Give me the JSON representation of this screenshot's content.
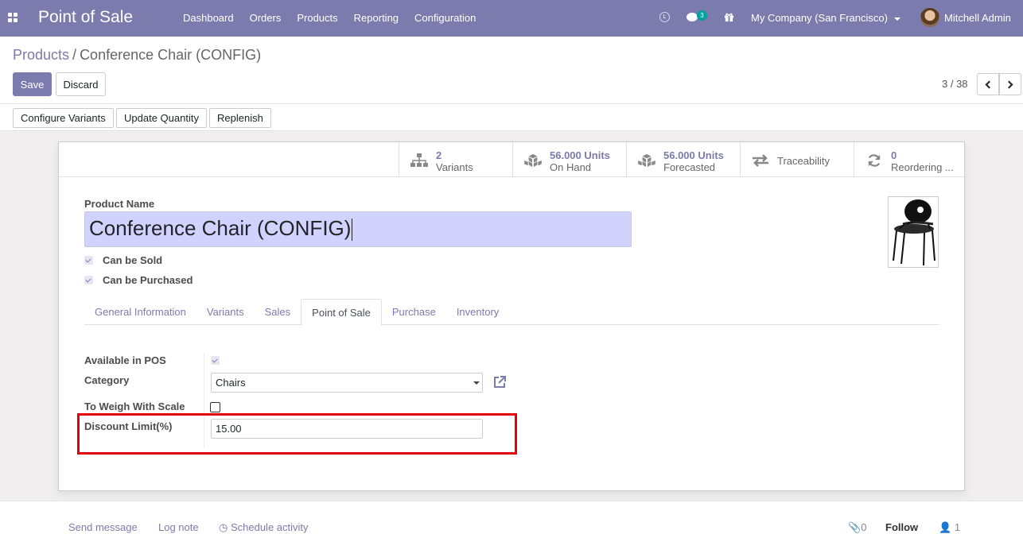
{
  "navbar": {
    "app_title": "Point of Sale",
    "menu": [
      "Dashboard",
      "Orders",
      "Products",
      "Reporting",
      "Configuration"
    ],
    "chat_count": "3",
    "company": "My Company (San Francisco)",
    "user": "Mitchell Admin",
    "brand_color": "#7c7bad"
  },
  "breadcrumb": {
    "parent": "Products",
    "separator": "/",
    "current": "Conference Chair (CONFIG)"
  },
  "actions": {
    "save_label": "Save",
    "discard_label": "Discard"
  },
  "pager": {
    "value": "3 / 38"
  },
  "header_buttons": [
    "Configure Variants",
    "Update Quantity",
    "Replenish"
  ],
  "smart_buttons": [
    {
      "icon": "sitemap-icon",
      "value": "2",
      "label": "Variants"
    },
    {
      "icon": "cubes-icon",
      "value": "56.000 Units",
      "label": "On Hand"
    },
    {
      "icon": "cubes-icon",
      "value": "56.000 Units",
      "label": "Forecasted"
    },
    {
      "icon": "exchange-icon",
      "value": "",
      "label": "Traceability"
    },
    {
      "icon": "refresh-icon",
      "value": "0",
      "label": "Reordering ..."
    }
  ],
  "product": {
    "name_label": "Product Name",
    "name": "Conference Chair (CONFIG)",
    "can_be_sold_label": "Can be Sold",
    "can_be_purchased_label": "Can be Purchased"
  },
  "tabs": [
    "General Information",
    "Variants",
    "Sales",
    "Point of Sale",
    "Purchase",
    "Inventory"
  ],
  "active_tab": "Point of Sale",
  "pos": {
    "available_label": "Available in POS",
    "category_label": "Category",
    "category_value": "Chairs",
    "weigh_label": "To Weigh With Scale",
    "discount_label": "Discount Limit(%)",
    "discount_value": "15.00",
    "highlight_color": "#e3000b"
  },
  "chatter": {
    "send_message": "Send message",
    "log_note": "Log note",
    "schedule_activity": "Schedule activity",
    "attachments": "0",
    "follow": "Follow",
    "followers": "1"
  }
}
